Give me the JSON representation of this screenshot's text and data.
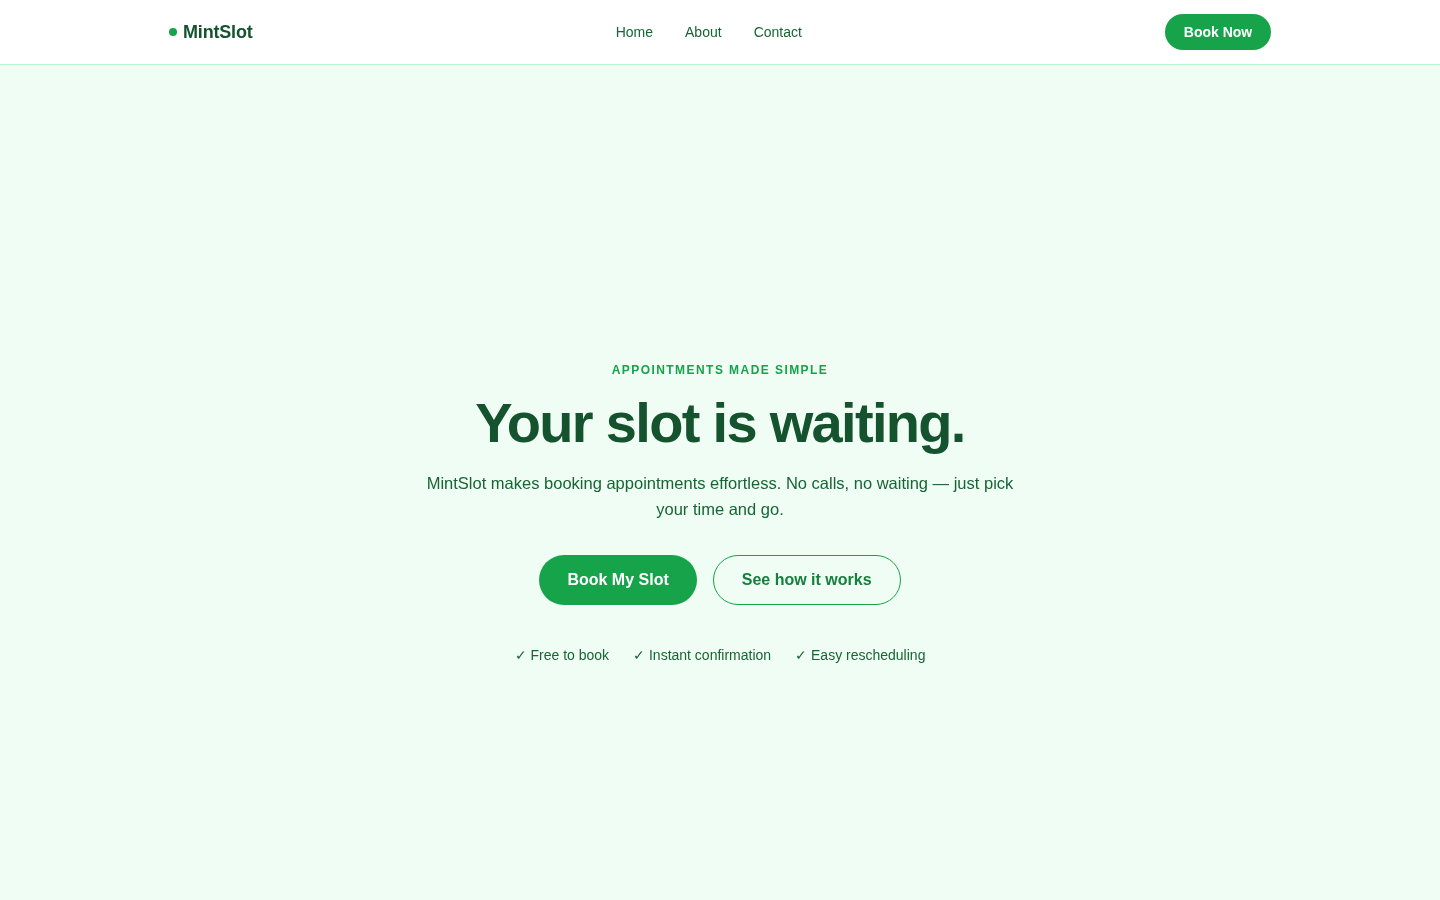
{
  "header": {
    "logo": {
      "text": "MintSlot"
    },
    "nav": [
      {
        "label": "Home"
      },
      {
        "label": "About"
      },
      {
        "label": "Contact"
      }
    ],
    "cta": "Book Now"
  },
  "hero": {
    "eyebrow": "APPOINTMENTS MADE SIMPLE",
    "title": "Your slot is waiting.",
    "subtitle": "MintSlot makes booking appointments effortless. No calls, no waiting — just pick your time and go.",
    "buttons": [
      {
        "label": "Book My Slot",
        "kind": "primary"
      },
      {
        "label": "See how it works",
        "kind": "outline"
      }
    ],
    "features": [
      "✓ Free to book",
      "✓ Instant confirmation",
      "✓ Easy rescheduling"
    ]
  }
}
